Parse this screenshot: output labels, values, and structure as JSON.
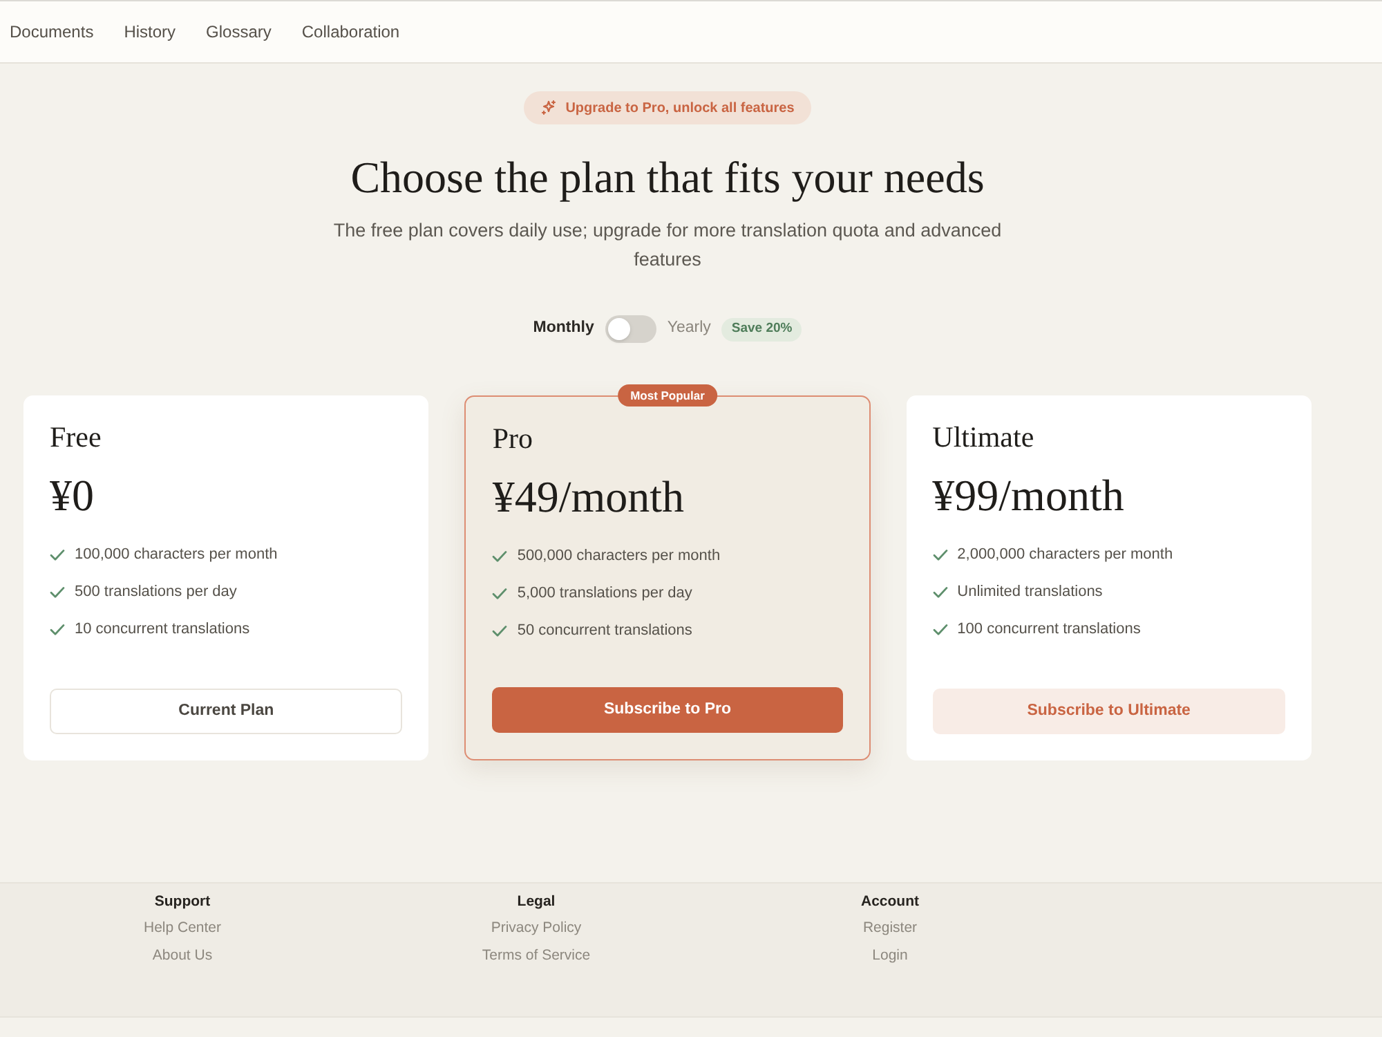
{
  "nav": {
    "items": [
      {
        "label": "Documents",
        "selected": false
      },
      {
        "label": "History",
        "selected": false
      },
      {
        "label": "Glossary",
        "selected": false
      },
      {
        "label": "Collaboration",
        "selected": false
      }
    ]
  },
  "promo_badge": {
    "label": "Upgrade to Pro, unlock all features"
  },
  "heading": "Choose the plan that fits your needs",
  "subtitle": "The free plan covers daily use; upgrade for more translation quota and advanced features",
  "billing_toggle": {
    "left_label": "Monthly",
    "right_label": "Yearly",
    "on": false,
    "discount_badge": "Save 20%"
  },
  "plans": [
    {
      "name": "Free",
      "price": "¥0",
      "highlighted": false,
      "features": [
        "100,000 characters per month",
        "500 translations per day",
        "10 concurrent translations"
      ],
      "button": {
        "label": "Current Plan",
        "kind": "outline"
      }
    },
    {
      "name": "Pro",
      "price": "¥49/month",
      "highlighted": true,
      "ribbon": "Most Popular",
      "features": [
        "500,000 characters per month",
        "5,000 translations per day",
        "50 concurrent translations"
      ],
      "button": {
        "label": "Subscribe to Pro",
        "kind": "primary"
      }
    },
    {
      "name": "Ultimate",
      "price": "¥99/month",
      "highlighted": false,
      "features": [
        "2,000,000 characters per month",
        "Unlimited translations",
        "100 concurrent translations"
      ],
      "button": {
        "label": "Subscribe to Ultimate",
        "kind": "soft"
      }
    }
  ],
  "footer": {
    "columns": [
      {
        "title": "Support",
        "links": [
          "Help Center",
          "About Us"
        ]
      },
      {
        "title": "Legal",
        "links": [
          "Privacy Policy",
          "Terms of Service"
        ]
      },
      {
        "title": "Account",
        "links": [
          "Register",
          "Login"
        ]
      }
    ]
  }
}
